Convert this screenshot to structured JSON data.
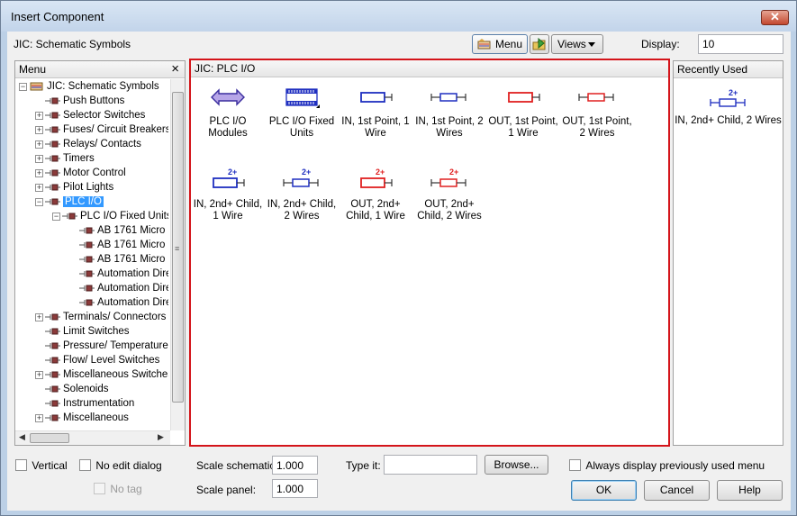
{
  "window": {
    "title": "Insert Component",
    "close_glyph": "✕"
  },
  "toolbar": {
    "library_label": "JIC: Schematic Symbols",
    "menu_button": "Menu",
    "views_button": "Views",
    "display_label": "Display:",
    "display_value": "10"
  },
  "menu_panel": {
    "header": "Menu",
    "close_glyph": "×",
    "items": [
      {
        "label": "JIC: Schematic Symbols",
        "level": 0,
        "expander": "−"
      },
      {
        "label": "Push Buttons",
        "level": 1,
        "expander": ""
      },
      {
        "label": "Selector Switches",
        "level": 1,
        "expander": "+"
      },
      {
        "label": "Fuses/ Circuit Breakers",
        "level": 1,
        "expander": "+"
      },
      {
        "label": "Relays/ Contacts",
        "level": 1,
        "expander": "+"
      },
      {
        "label": "Timers",
        "level": 1,
        "expander": "+"
      },
      {
        "label": "Motor Control",
        "level": 1,
        "expander": "+"
      },
      {
        "label": "Pilot Lights",
        "level": 1,
        "expander": "+"
      },
      {
        "label": "PLC I/O",
        "level": 1,
        "expander": "−",
        "selected": true
      },
      {
        "label": "PLC I/O Fixed Units",
        "level": 2,
        "expander": "−"
      },
      {
        "label": "AB 1761 Micro",
        "level": 3,
        "expander": ""
      },
      {
        "label": "AB 1761 Micro",
        "level": 3,
        "expander": ""
      },
      {
        "label": "AB 1761 Micro",
        "level": 3,
        "expander": ""
      },
      {
        "label": "Automation Dire",
        "level": 3,
        "expander": ""
      },
      {
        "label": "Automation Dire",
        "level": 3,
        "expander": ""
      },
      {
        "label": "Automation Dire",
        "level": 3,
        "expander": ""
      },
      {
        "label": "Terminals/ Connectors",
        "level": 1,
        "expander": "+"
      },
      {
        "label": "Limit Switches",
        "level": 1,
        "expander": ""
      },
      {
        "label": "Pressure/ Temperature",
        "level": 1,
        "expander": ""
      },
      {
        "label": "Flow/ Level Switches",
        "level": 1,
        "expander": ""
      },
      {
        "label": "Miscellaneous Switches",
        "level": 1,
        "expander": "+"
      },
      {
        "label": "Solenoids",
        "level": 1,
        "expander": ""
      },
      {
        "label": "Instrumentation",
        "level": 1,
        "expander": ""
      },
      {
        "label": "Miscellaneous",
        "level": 1,
        "expander": "+"
      }
    ]
  },
  "center_panel": {
    "header": "JIC: PLC I/O",
    "components": [
      {
        "label": "PLC I/O Modules",
        "icon": "plc-modules-icon"
      },
      {
        "label": "PLC I/O Fixed Units",
        "icon": "plc-fixed-units-icon"
      },
      {
        "label": "IN, 1st Point, 1 Wire",
        "icon": "input-1st-point-1-wire-icon"
      },
      {
        "label": "IN, 1st Point, 2 Wires",
        "icon": "input-1st-point-2-wires-icon"
      },
      {
        "label": "OUT, 1st Point, 1 Wire",
        "icon": "output-1st-point-1-wire-icon"
      },
      {
        "label": "OUT, 1st Point, 2 Wires",
        "icon": "output-1st-point-2-wires-icon"
      },
      {
        "label": "IN, 2nd+ Child, 1 Wire",
        "icon": "input-child-1-wire-icon",
        "badge": "2+"
      },
      {
        "label": "IN, 2nd+ Child, 2 Wires",
        "icon": "input-child-2-wires-icon",
        "badge": "2+"
      },
      {
        "label": "OUT, 2nd+ Child, 1 Wire",
        "icon": "output-child-1-wire-icon",
        "badge": "2+"
      },
      {
        "label": "OUT, 2nd+ Child, 2 Wires",
        "icon": "output-child-2-wires-icon",
        "badge": "2+"
      }
    ]
  },
  "recent_panel": {
    "header": "Recently Used",
    "items": [
      {
        "label": "IN, 2nd+ Child, 2 Wires",
        "badge": "2+"
      }
    ]
  },
  "bottom": {
    "vertical_label": "Vertical",
    "no_edit_dialog_label": "No edit dialog",
    "no_tag_label": "No tag",
    "scale_schematic_label": "Scale schematic:",
    "scale_schematic_value": "1.000",
    "scale_panel_label": "Scale panel:",
    "scale_panel_value": "1.000",
    "type_it_label": "Type it:",
    "type_it_value": "",
    "browse_button": "Browse...",
    "always_display_label": "Always display previously used menu",
    "ok_button": "OK",
    "cancel_button": "Cancel",
    "help_button": "Help"
  },
  "colors": {
    "in_blue": "#1f2fc0",
    "out_red": "#e02020",
    "selection": "#3399ff",
    "highlight_border": "#d4141a"
  }
}
